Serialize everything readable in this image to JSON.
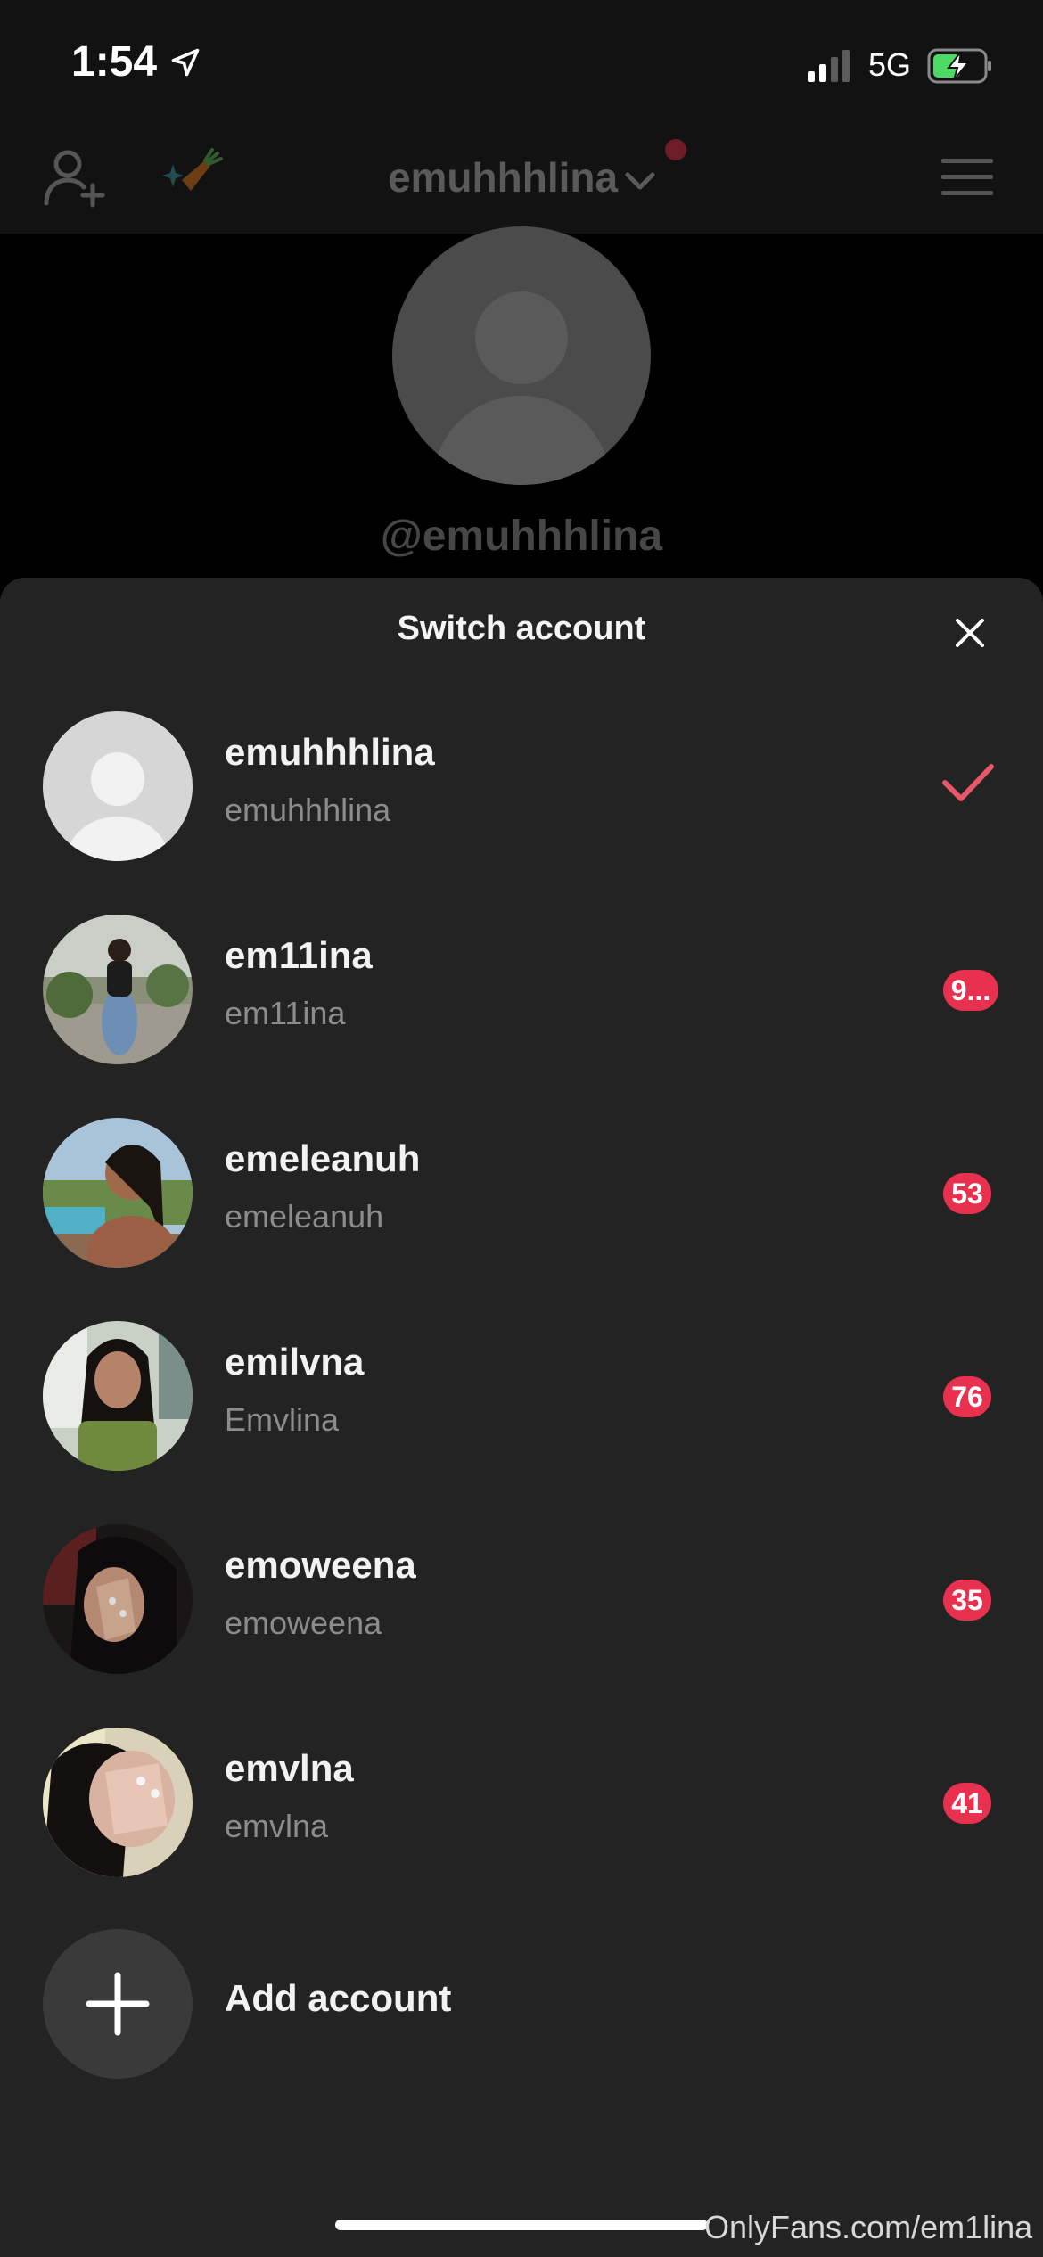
{
  "status_bar": {
    "time": "1:54",
    "network": "5G"
  },
  "top_nav": {
    "username": "emuhhhlina",
    "notification_dot_color": "#6e1c26"
  },
  "profile_background": {
    "handle": "@emuhhhlina"
  },
  "sheet": {
    "title": "Switch account",
    "accounts": [
      {
        "name": "emuhhhlina",
        "handle": "emuhhhlina",
        "selected": true,
        "badge": ""
      },
      {
        "name": "em11ina",
        "handle": "em11ina",
        "selected": false,
        "badge": "9..."
      },
      {
        "name": "emeleanuh",
        "handle": "emeleanuh",
        "selected": false,
        "badge": "53"
      },
      {
        "name": "emilvna",
        "handle": "Emvlina",
        "selected": false,
        "badge": "76"
      },
      {
        "name": "emoweena",
        "handle": "emoweena",
        "selected": false,
        "badge": "35"
      },
      {
        "name": "emvlna",
        "handle": "emvlna",
        "selected": false,
        "badge": "41"
      }
    ],
    "add_account_label": "Add account"
  },
  "watermark": "OnlyFans.com/em1lina",
  "colors": {
    "badge": "#e8314f",
    "check": "#e8566a",
    "sheet_bg": "#232323"
  }
}
